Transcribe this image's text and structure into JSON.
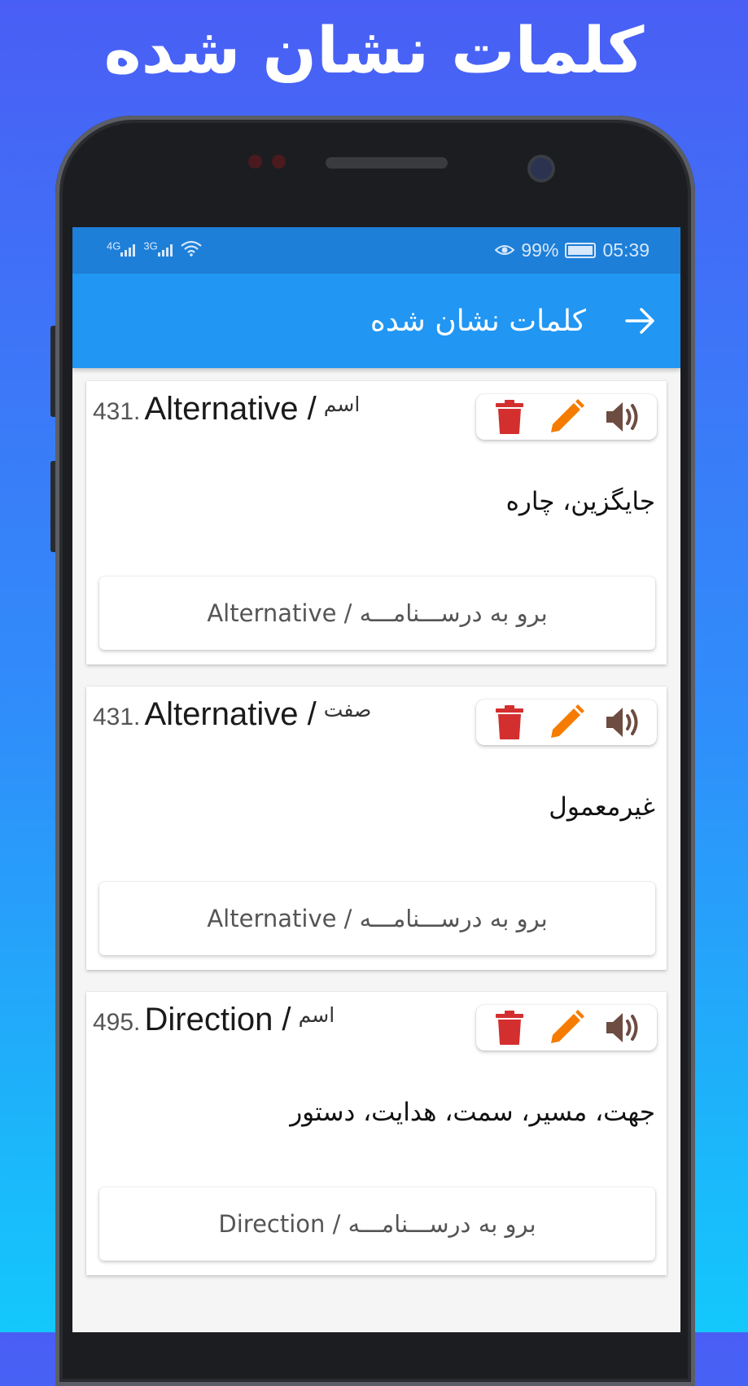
{
  "promo": {
    "title": "کلمات نشان شده"
  },
  "status_bar": {
    "network_1": "4G",
    "network_2": "3G",
    "battery": "99%",
    "time": "05:39"
  },
  "app_bar": {
    "title": "کلمات نشان شده"
  },
  "cards": [
    {
      "number": "431.",
      "word": "Alternative /",
      "pos": "اسم",
      "meaning": "جایگزین، چاره",
      "goto_label": "برو به درســـنامـــه / Alternative"
    },
    {
      "number": "431.",
      "word": "Alternative /",
      "pos": "صفت",
      "meaning": "غیرمعمول",
      "goto_label": "برو به درســـنامـــه / Alternative"
    },
    {
      "number": "495.",
      "word": "Direction /",
      "pos": "اسم",
      "meaning": "جهت، مسیر، سمت، هدایت، دستور",
      "goto_label": "برو به درســـنامـــه / Direction"
    }
  ],
  "icons": {
    "delete": "trash-icon",
    "edit": "pencil-icon",
    "speak": "speaker-icon"
  },
  "colors": {
    "app_bar": "#2196f3",
    "status_bar": "#1e7fd8",
    "delete": "#d32f2f",
    "edit": "#f57c00",
    "speaker": "#6d4c41"
  }
}
